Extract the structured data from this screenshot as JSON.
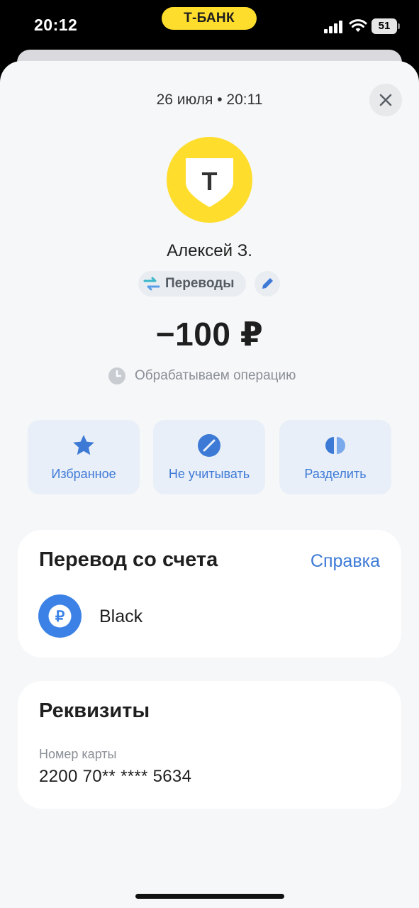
{
  "status_bar": {
    "time": "20:12",
    "brand": "Т-БАНК",
    "battery": "51",
    "icons": [
      "signal-icon",
      "wifi-icon",
      "battery-icon"
    ]
  },
  "header": {
    "date": "26 июля • 20:11",
    "close_icon": "close-icon"
  },
  "recipient": {
    "name": "Алексей З.",
    "logo_icon": "t-bank-logo-icon",
    "logo_letter": "Т"
  },
  "category": {
    "label": "Переводы",
    "icon": "transfer-arrows-icon",
    "edit_icon": "pencil-icon"
  },
  "amount": "−100 ₽",
  "status": {
    "text": "Обрабатываем операцию",
    "icon": "clock-icon"
  },
  "actions": [
    {
      "label": "Избранное",
      "icon": "star-icon"
    },
    {
      "label": "Не учитывать",
      "icon": "crossed-circle-icon"
    },
    {
      "label": "Разделить",
      "icon": "split-icon"
    }
  ],
  "account_card": {
    "title": "Перевод со счета",
    "help": "Справка",
    "account_name": "Black",
    "account_icon": "ruble-icon",
    "account_symbol": "₽"
  },
  "requisites_card": {
    "title": "Реквизиты",
    "field_label": "Номер карты",
    "field_value": "2200 70** **** 5634"
  },
  "colors": {
    "brand_yellow": "#ffdd2d",
    "accent_blue": "#3d7ad6",
    "action_bg": "#e9eff8",
    "sheet_bg": "#f6f7f8"
  }
}
